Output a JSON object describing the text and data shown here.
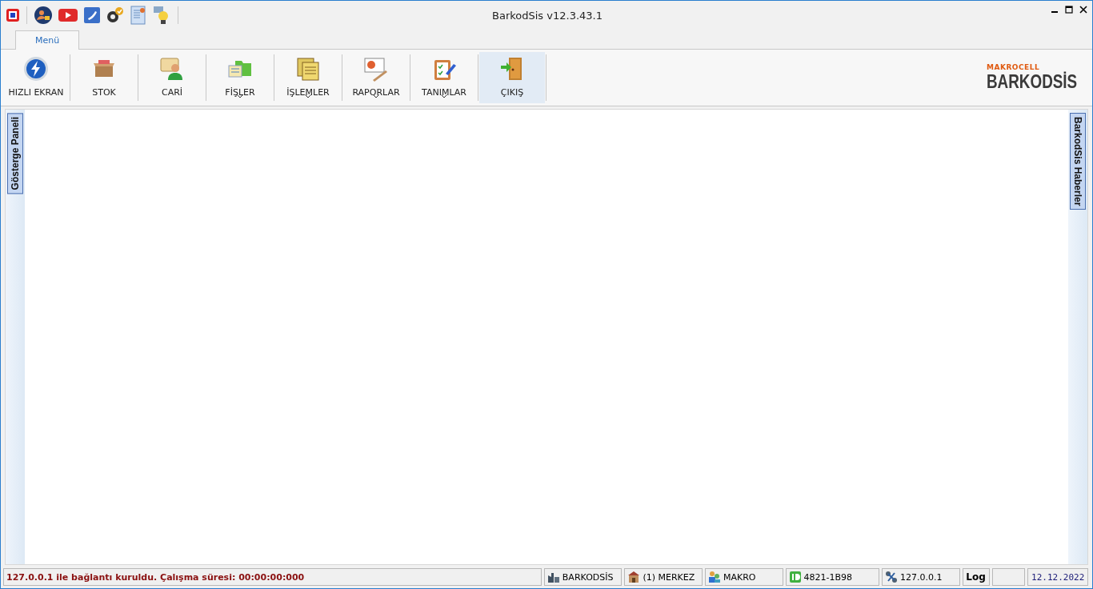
{
  "window": {
    "title": "BarkodSis v12.3.43.1"
  },
  "tabs": [
    {
      "label": "Menü",
      "selected": true
    }
  ],
  "ribbon": [
    {
      "label": "HIZLI EKRAN",
      "kind": "button",
      "selected": false
    },
    {
      "label": "STOK",
      "kind": "button",
      "selected": false
    },
    {
      "label": "CARİ",
      "kind": "button",
      "selected": false
    },
    {
      "label": "FİŞLER",
      "kind": "dropdown",
      "selected": false
    },
    {
      "label": "İŞLEMLER",
      "kind": "dropdown",
      "selected": false
    },
    {
      "label": "RAPORLAR",
      "kind": "dropdown",
      "selected": false
    },
    {
      "label": "TANIMLAR",
      "kind": "dropdown",
      "selected": false
    },
    {
      "label": "ÇIKIŞ",
      "kind": "button",
      "selected": true
    }
  ],
  "logo": {
    "top": "MAKROCELL",
    "main": "BARKODSİS"
  },
  "side_tabs": {
    "left": "Gösterge Paneli",
    "right": "BarkodSis Haberler"
  },
  "status_bar": {
    "message": "127.0.0.1 ile bağlantı kuruldu. Çalışma süresi: 00:00:00:000",
    "panels": [
      {
        "text": "BARKODSİS"
      },
      {
        "text": "(1) MERKEZ"
      },
      {
        "text": "MAKRO"
      },
      {
        "text": "4821-1B98"
      },
      {
        "text": "127.0.0.1"
      }
    ],
    "log": "Log",
    "date": "12.12.2022"
  }
}
